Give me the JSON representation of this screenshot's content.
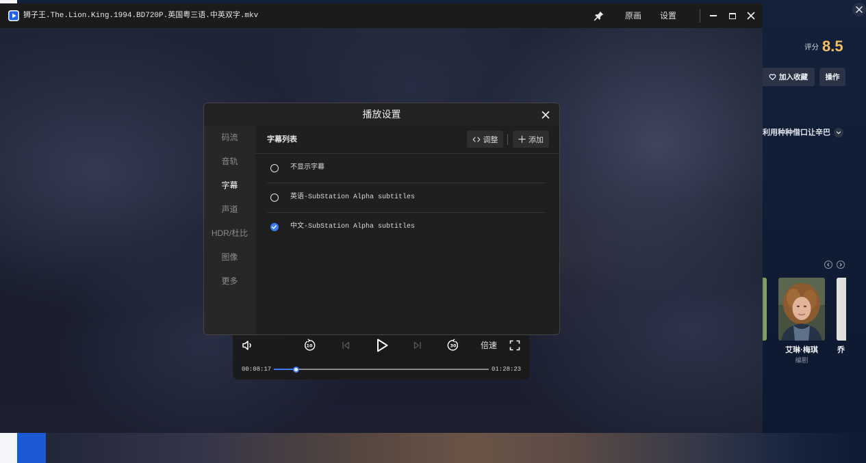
{
  "player": {
    "title": "狮子王.The.Lion.King.1994.BD720P.英国粤三语.中英双字.mkv",
    "quality_label": "原画",
    "settings_label": "设置"
  },
  "settings_dialog": {
    "title": "播放设置",
    "tabs": [
      {
        "label": "码流",
        "active": false
      },
      {
        "label": "音轨",
        "active": false
      },
      {
        "label": "字幕",
        "active": true
      },
      {
        "label": "声道",
        "active": false
      },
      {
        "label": "HDR/杜比",
        "active": false
      },
      {
        "label": "图像",
        "active": false
      },
      {
        "label": "更多",
        "active": false
      }
    ],
    "subtitles": {
      "heading": "字幕列表",
      "adjust_label": "调整",
      "add_label": "添加",
      "options": [
        {
          "label": "不显示字幕",
          "selected": false
        },
        {
          "label": "英语-SubStation Alpha subtitles",
          "selected": false
        },
        {
          "label": "中文-SubStation Alpha subtitles",
          "selected": true
        }
      ]
    }
  },
  "controls": {
    "replay_seconds": "10",
    "forward_seconds": "30",
    "speed_label": "倍速",
    "current_time": "00:08:17",
    "duration": "01:28:23",
    "progress": 0.105
  },
  "detail": {
    "rating_label": "评分",
    "rating_value": "8.5",
    "favorite_label": "加入收藏",
    "actions_label": "操作",
    "synopsis": "利用种种借口让辛巴",
    "cast": [
      {
        "name": "艾琳·梅琪",
        "role": "编剧"
      },
      {
        "name": "乔"
      }
    ]
  },
  "colors": {
    "accent": "#3d7bf4",
    "rating": "#f5bf5f"
  },
  "icons": {
    "app": "play-logo-icon",
    "pin": "pin-icon",
    "window_controls": [
      "minimize-icon",
      "maximize-icon",
      "close-icon"
    ],
    "playback": [
      "volume-icon",
      "replay-10-icon",
      "previous-icon",
      "play-icon",
      "next-icon",
      "forward-30-icon",
      "fullscreen-icon"
    ],
    "favorite": "heart-icon"
  }
}
